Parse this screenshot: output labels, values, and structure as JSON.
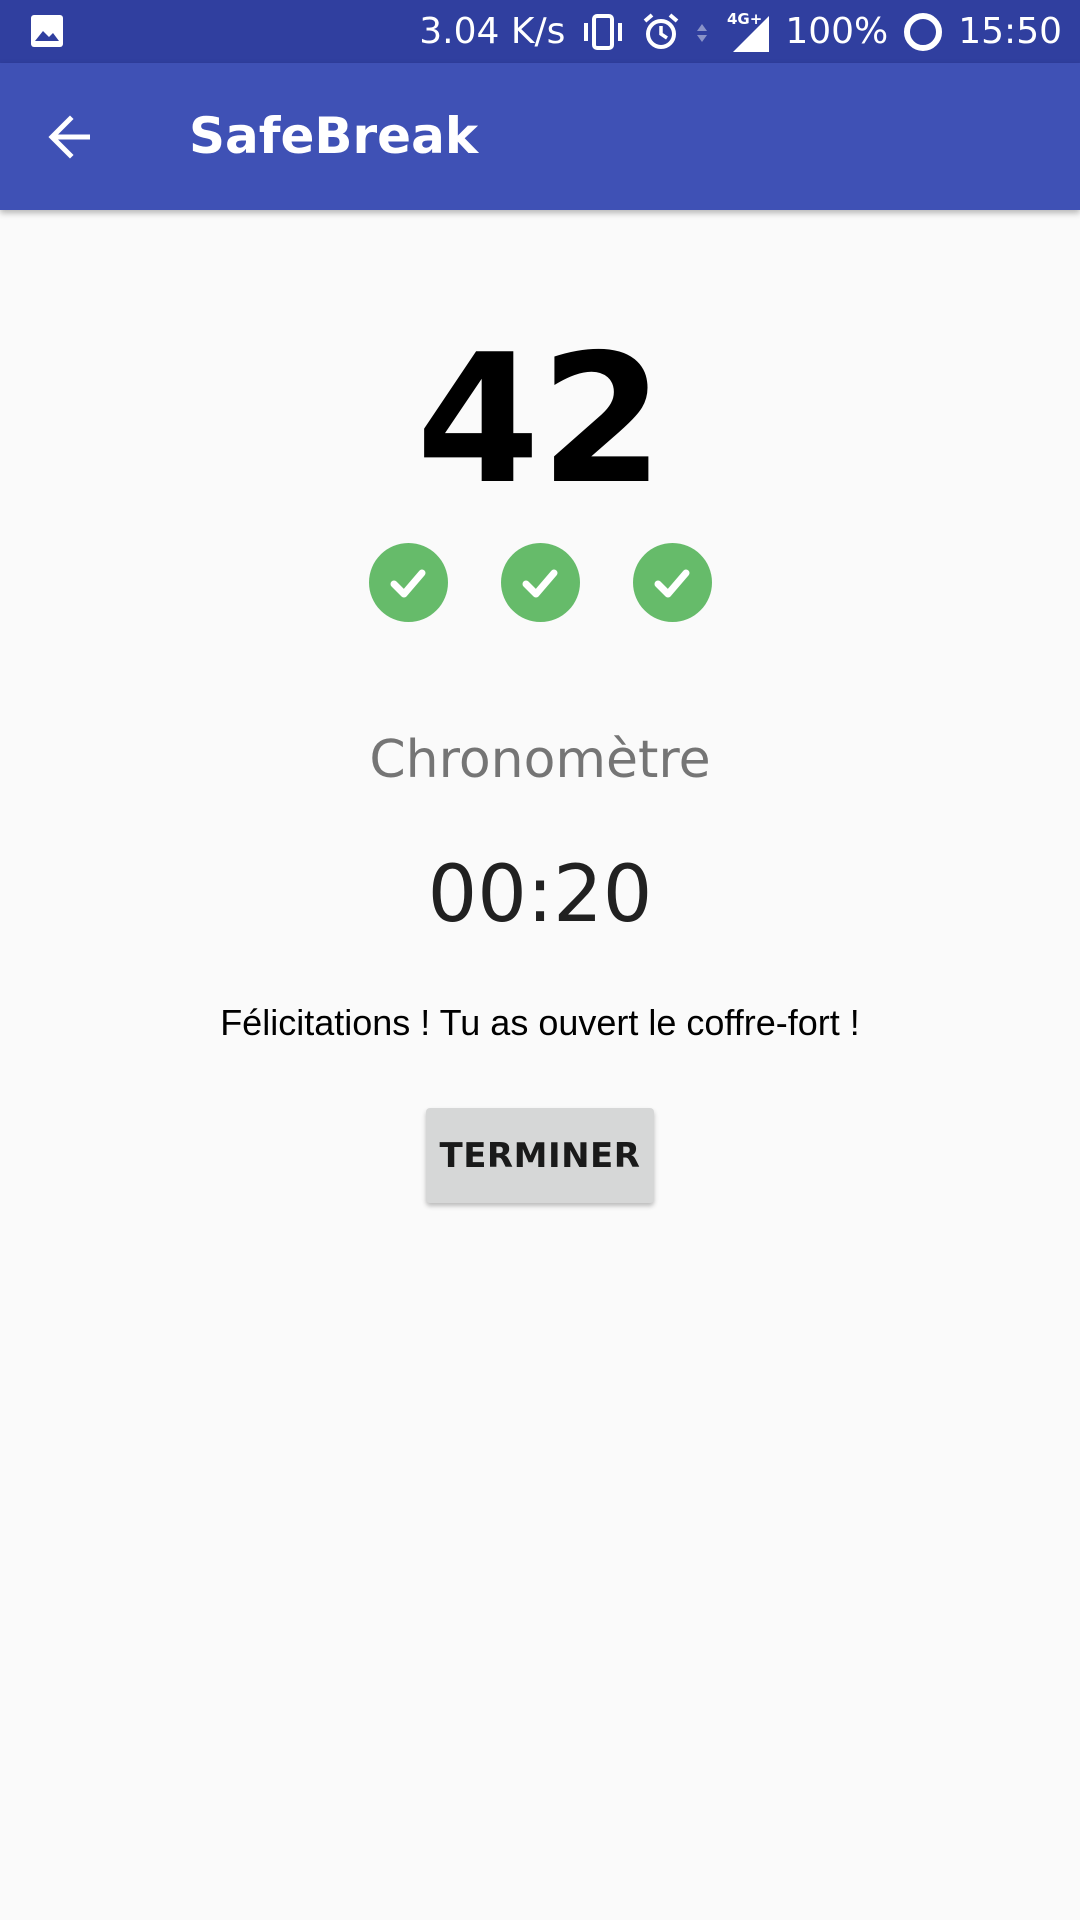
{
  "status_bar": {
    "notification_icon": "gallery-icon",
    "network_speed": "3.04 K/s",
    "icons": [
      "vibrate-icon",
      "alarm-icon",
      "data-arrows-icon",
      "signal-4g-icon"
    ],
    "network_type": "4G+",
    "battery": "100%",
    "time": "15:50"
  },
  "app_bar": {
    "back_icon": "arrow-back-icon",
    "title": "SafeBreak"
  },
  "main": {
    "code": "42",
    "checks": [
      {
        "icon": "check-circle-icon",
        "color": "#66bb6a"
      },
      {
        "icon": "check-circle-icon",
        "color": "#66bb6a"
      },
      {
        "icon": "check-circle-icon",
        "color": "#66bb6a"
      }
    ],
    "chrono_label": "Chronomètre",
    "chrono_value": "00:20",
    "message": "Félicitations ! Tu as ouvert le coffre-fort !",
    "finish_button": "TERMINER"
  },
  "colors": {
    "status_bar": "#303f9f",
    "app_bar": "#3f51b5",
    "check": "#66bb6a",
    "background": "#fafafa"
  }
}
